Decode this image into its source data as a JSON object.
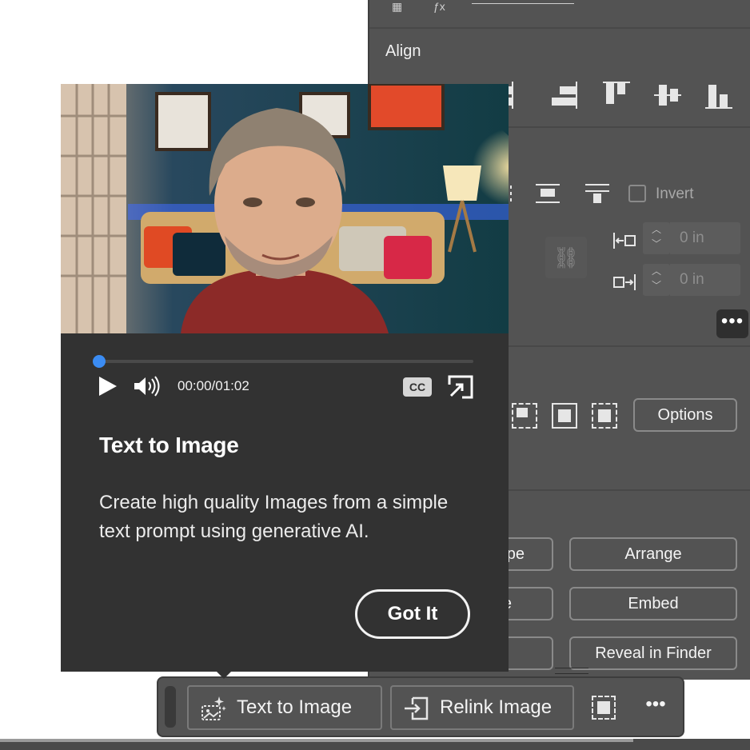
{
  "panel": {
    "align": {
      "title": "Align"
    },
    "invert": {
      "label": "Invert"
    },
    "offset_left": {
      "value": "0 in"
    },
    "offset_right": {
      "value": "0 in"
    },
    "more_label": "•••",
    "options_label": "Options",
    "quick_actions": {
      "shape_partial": "pe",
      "partial_2": "e",
      "arrange": "Arrange",
      "embed": "Embed",
      "reveal": "Reveal in Finder"
    }
  },
  "popover": {
    "video": {
      "time": "00:00/01:02",
      "progress_fraction": 0.0,
      "cc_label": "CC"
    },
    "title": "Text to Image",
    "description": "Create high quality Images from a simple text prompt using generative AI.",
    "got_it_label": "Got It"
  },
  "context_bar": {
    "text_to_image_label": "Text to Image",
    "relink_label": "Relink Image",
    "more_label": "•••"
  },
  "colors": {
    "panel_bg": "#535353",
    "popover_bg": "#323232",
    "accent_blue": "#3b8cf3"
  }
}
